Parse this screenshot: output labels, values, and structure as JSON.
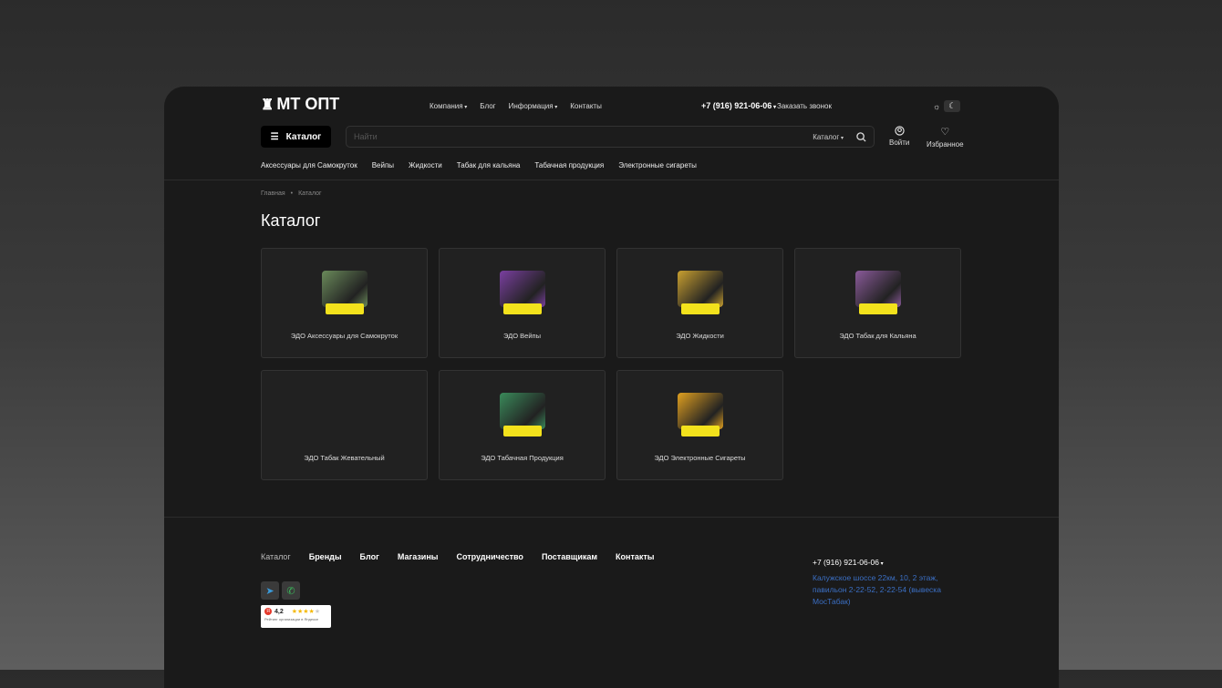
{
  "logo": "МТ ОПТ",
  "topnav": [
    {
      "label": "Компания",
      "caret": true
    },
    {
      "label": "Блог"
    },
    {
      "label": "Информация",
      "caret": true
    },
    {
      "label": "Контакты"
    }
  ],
  "phone": "+7 (916) 921-06-06",
  "callback": "Заказать звонок",
  "catalog_button": "Каталог",
  "search": {
    "placeholder": "Найти",
    "scope": "Каталог"
  },
  "login": "Войти",
  "favorites": "Избранное",
  "catnav": [
    "Аксессуары для Самокруток",
    "Вейпы",
    "Жидкости",
    "Табак для кальяна",
    "Табачная продукция",
    "Электронные сигареты"
  ],
  "breadcrumbs": [
    "Главная",
    "Каталог"
  ],
  "title": "Каталог",
  "cards": [
    {
      "label": "ЭДО Аксессуары для Самокруток",
      "color": "#6a8a5a"
    },
    {
      "label": "ЭДО Вейпы",
      "color": "#7a3fa0"
    },
    {
      "label": "ЭДО Жидкости",
      "color": "#c9a030"
    },
    {
      "label": "ЭДО Табак для Кальяна",
      "color": "#8a5a9a"
    },
    {
      "label": "ЭДО Табак Жевательный",
      "color": ""
    },
    {
      "label": "ЭДО Табачная Продукция",
      "color": "#3a8a5a"
    },
    {
      "label": "ЭДО Электронные Сигареты",
      "color": "#e0a020"
    }
  ],
  "footer": {
    "nav": [
      "Каталог",
      "Бренды",
      "Блог",
      "Магазины",
      "Сотрудничество",
      "Поставщикам",
      "Контакты"
    ],
    "phone": "+7 (916) 921-06-06",
    "address": "Калужское шоссе 22км, 10, 2 этаж, павильон 2-22-52, 2-22-54 (вывеска МосТабак)",
    "rating": {
      "value": "4,2",
      "stars": 4.2,
      "caption": "Рейтинг организации в Яндексе"
    }
  }
}
